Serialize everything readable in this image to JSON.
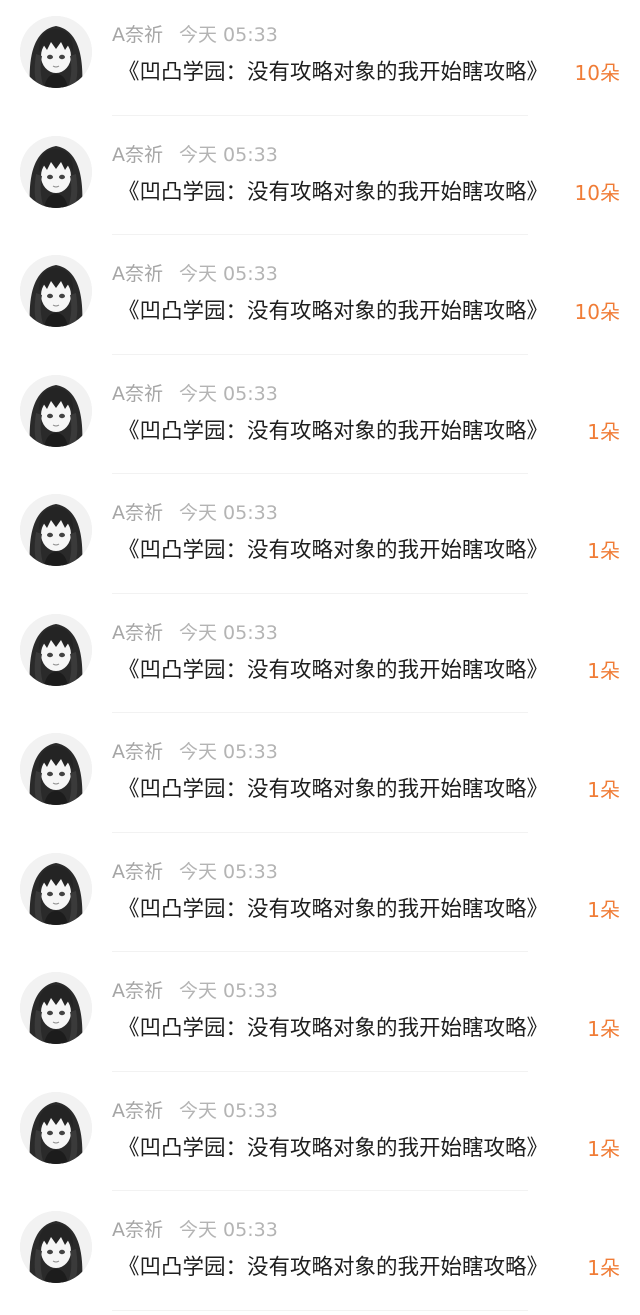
{
  "accent_color": "#f07c36",
  "avatar_icon": "anime-girl-avatar",
  "rows": [
    {
      "name": "A奈祈",
      "time": "今天 05:33",
      "title": "《凹凸学园：没有攻略对象的我开始瞎攻略》",
      "count": "10朵"
    },
    {
      "name": "A奈祈",
      "time": "今天 05:33",
      "title": "《凹凸学园：没有攻略对象的我开始瞎攻略》",
      "count": "10朵"
    },
    {
      "name": "A奈祈",
      "time": "今天 05:33",
      "title": "《凹凸学园：没有攻略对象的我开始瞎攻略》",
      "count": "10朵"
    },
    {
      "name": "A奈祈",
      "time": "今天 05:33",
      "title": "《凹凸学园：没有攻略对象的我开始瞎攻略》",
      "count": "1朵"
    },
    {
      "name": "A奈祈",
      "time": "今天 05:33",
      "title": "《凹凸学园：没有攻略对象的我开始瞎攻略》",
      "count": "1朵"
    },
    {
      "name": "A奈祈",
      "time": "今天 05:33",
      "title": "《凹凸学园：没有攻略对象的我开始瞎攻略》",
      "count": "1朵"
    },
    {
      "name": "A奈祈",
      "time": "今天 05:33",
      "title": "《凹凸学园：没有攻略对象的我开始瞎攻略》",
      "count": "1朵"
    },
    {
      "name": "A奈祈",
      "time": "今天 05:33",
      "title": "《凹凸学园：没有攻略对象的我开始瞎攻略》",
      "count": "1朵"
    },
    {
      "name": "A奈祈",
      "time": "今天 05:33",
      "title": "《凹凸学园：没有攻略对象的我开始瞎攻略》",
      "count": "1朵"
    },
    {
      "name": "A奈祈",
      "time": "今天 05:33",
      "title": "《凹凸学园：没有攻略对象的我开始瞎攻略》",
      "count": "1朵"
    },
    {
      "name": "A奈祈",
      "time": "今天 05:33",
      "title": "《凹凸学园：没有攻略对象的我开始瞎攻略》",
      "count": "1朵"
    }
  ]
}
